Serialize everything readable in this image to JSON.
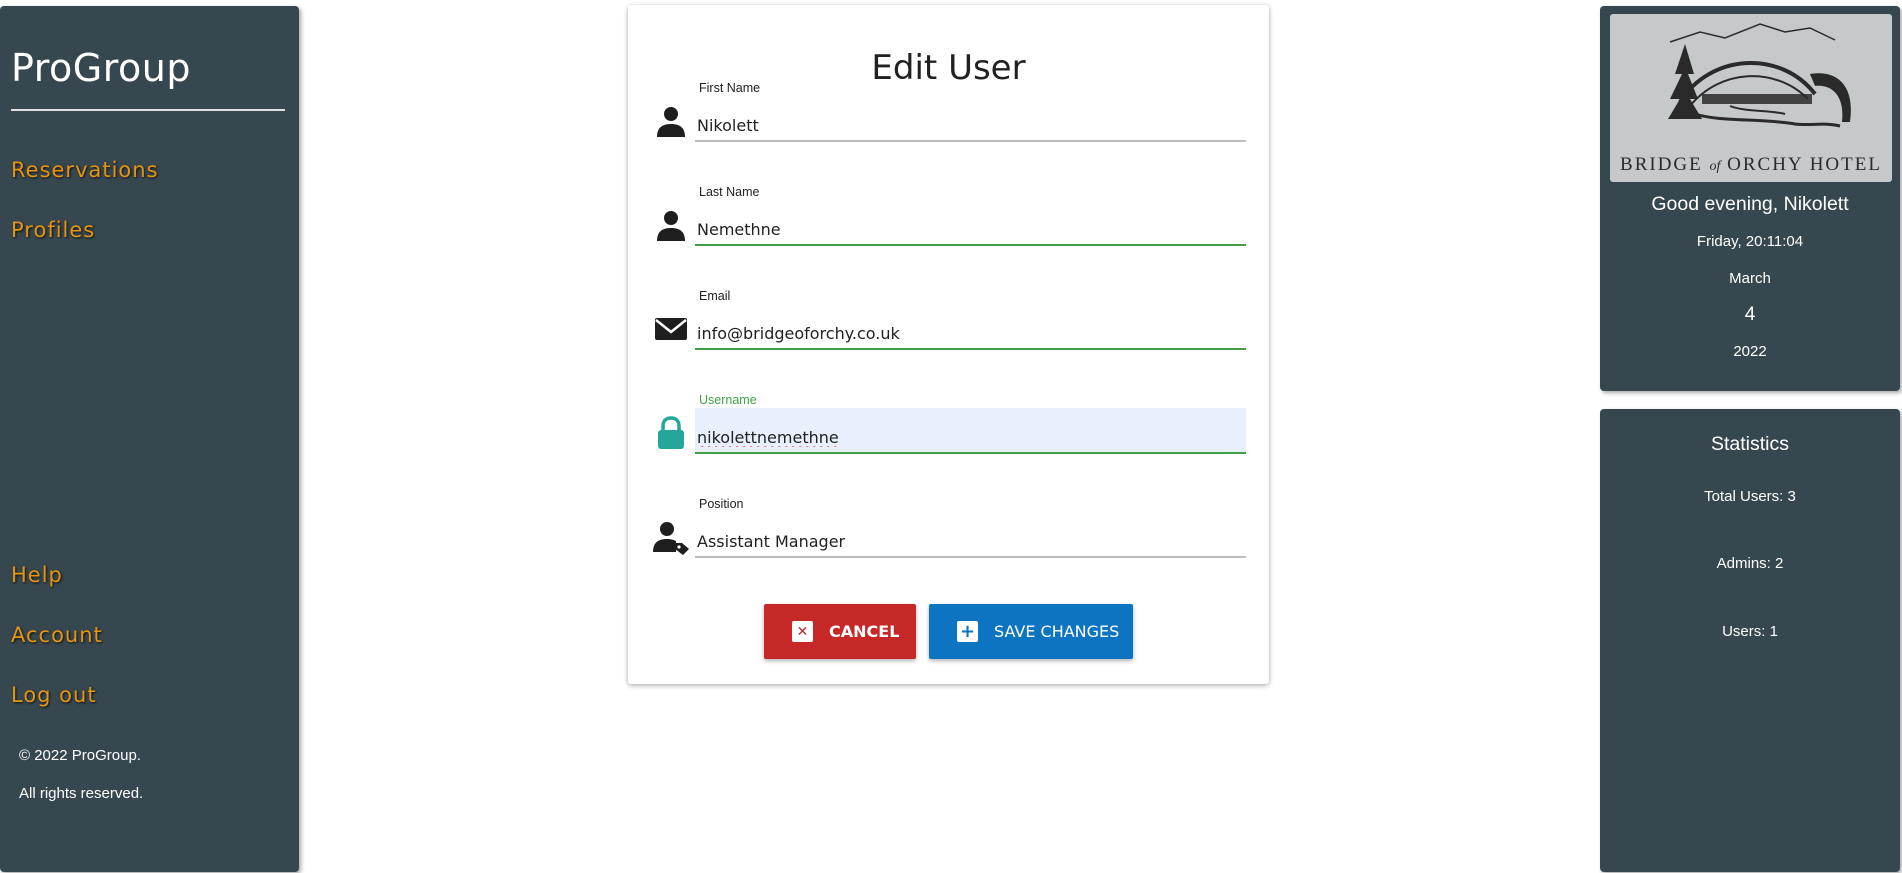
{
  "sidebar": {
    "brand": "ProGroup",
    "nav": [
      {
        "label": "Reservations"
      },
      {
        "label": "Profiles"
      }
    ],
    "bottom_nav": [
      {
        "label": "Help"
      },
      {
        "label": "Account"
      },
      {
        "label": "Log out"
      }
    ],
    "footer": {
      "copyright": "© 2022 ProGroup.",
      "rights": "All rights reserved."
    },
    "accent_color": "#e69512",
    "background_color": "#37474f"
  },
  "form": {
    "title": "Edit User",
    "fields": [
      {
        "label": "First Name",
        "value": "Nikolett",
        "icon": "person-icon"
      },
      {
        "label": "Last Name",
        "value": "Nemethne",
        "icon": "person-icon"
      },
      {
        "label": "Email",
        "value": "info@bridgeoforchy.co.uk",
        "icon": "envelope-icon"
      },
      {
        "label": "Username",
        "value": "nikolettnemethne",
        "icon": "lock-icon"
      },
      {
        "label": "Position",
        "value": "Assistant Manager",
        "icon": "person-tag-icon"
      }
    ],
    "buttons": {
      "cancel": "CANCEL",
      "save": "SAVE CHANGES"
    },
    "colors": {
      "valid": "#43a047",
      "cancel": "#c62828",
      "save": "#0d74c2",
      "lock_icon": "#26a69a"
    }
  },
  "info": {
    "logo_text": "BRIDGE",
    "logo_text_of": "of",
    "logo_text_end": "ORCHY HOTEL",
    "greeting": "Good evening, Nikolett",
    "day_time": "Friday, 20:11:04",
    "month": "March",
    "day": "4",
    "year": "2022"
  },
  "stats": {
    "title": "Statistics",
    "total_users": "Total Users: 3",
    "admins": "Admins: 2",
    "users": "Users: 1"
  }
}
